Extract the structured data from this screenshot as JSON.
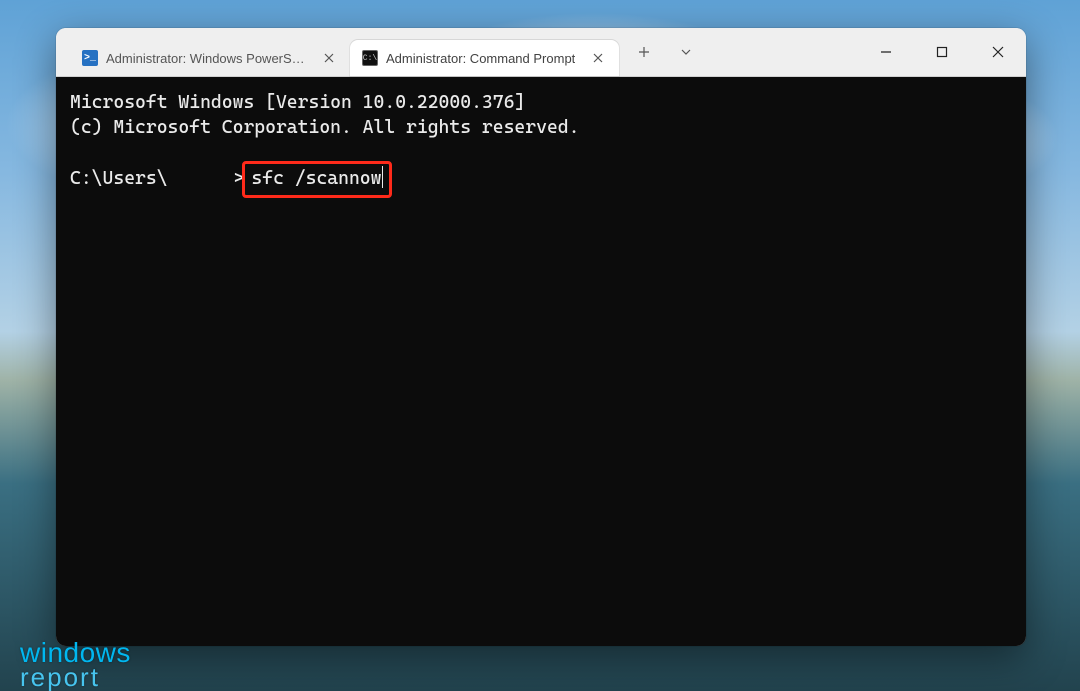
{
  "watermark": {
    "line1": "windows",
    "line2": "report"
  },
  "window": {
    "tabs": [
      {
        "icon": "powershell-icon",
        "title": "Administrator: Windows PowerShell",
        "active": false
      },
      {
        "icon": "cmd-icon",
        "title": "Administrator: Command Prompt",
        "active": true
      }
    ]
  },
  "terminal": {
    "banner_line1": "Microsoft Windows [Version 10.0.22000.376]",
    "banner_line2": "(c) Microsoft Corporation. All rights reserved.",
    "prompt_prefix": "C:\\Users\\",
    "prompt_suffix": ">",
    "command": "sfc /scannow"
  }
}
